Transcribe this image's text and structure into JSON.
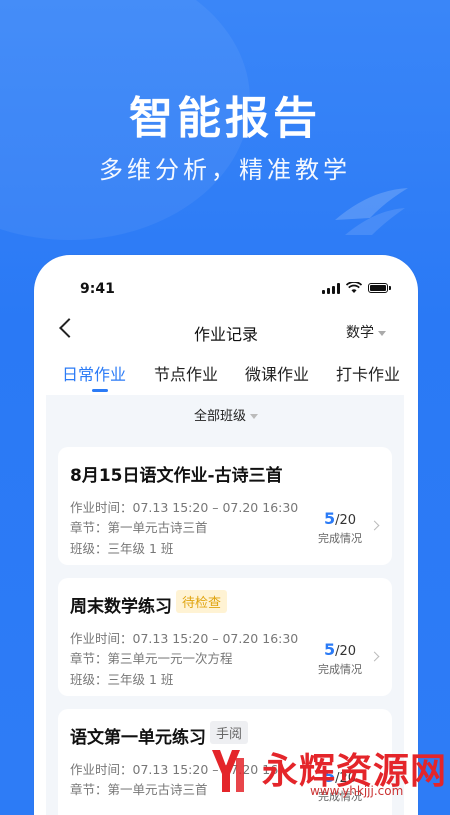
{
  "headline": "智能报告",
  "subline": "多维分析，精准教学",
  "statusbar": {
    "time": "9:41"
  },
  "navbar": {
    "title": "作业记录",
    "subject": "数学"
  },
  "tabs": [
    {
      "label": "日常作业",
      "active": true
    },
    {
      "label": "节点作业",
      "active": false
    },
    {
      "label": "微课作业",
      "active": false
    },
    {
      "label": "打卡作业",
      "active": false
    }
  ],
  "filter": {
    "label": "全部班级"
  },
  "cards": [
    {
      "title": "8月15日语文作业-古诗三首",
      "badge": "",
      "time": "作业时间：07.13 15:20 – 07.20 16:30",
      "chapter": "章节：第一单元古诗三首",
      "class": "班级：三年级 1 班",
      "done": "5",
      "total": "/20",
      "progress_label": "完成情况"
    },
    {
      "title": "周末数学练习",
      "badge": "待检查",
      "time": "作业时间：07.13 15:20 – 07.20 16:30",
      "chapter": "章节：第三单元一元一次方程",
      "class": "班级：三年级 1 班",
      "done": "5",
      "total": "/20",
      "progress_label": "完成情况"
    },
    {
      "title": "语文第一单元练习",
      "badge": "手阅",
      "time": "作业时间：07.13 15:20 – 07.20 16",
      "chapter": "章节：第一单元古诗三首",
      "class": "",
      "done": "5",
      "total": "/20",
      "progress_label": "完成情况"
    }
  ],
  "watermark": {
    "text": "永辉资源网",
    "url": "www.yhkjjj.com"
  },
  "colors": {
    "accent": "#2b7bf6",
    "background": "#2c7bf6",
    "badge_pending": "#e0a410",
    "watermark": "#e4252a"
  }
}
